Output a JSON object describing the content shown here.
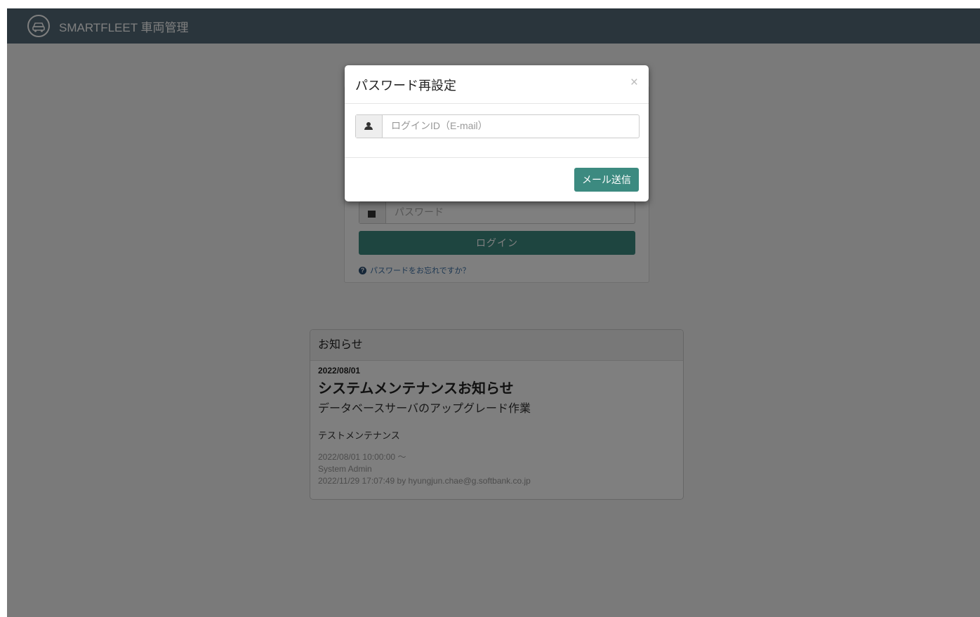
{
  "header": {
    "brand": "SMARTFLEET 車両管理",
    "logo_icon": "car-icon"
  },
  "login": {
    "password_placeholder": "パスワード",
    "login_button": "ログイン",
    "forgot_link": "パスワードをお忘れですか？"
  },
  "news": {
    "heading": "お知らせ",
    "date": "2022/08/01",
    "title": "システムメンテナンスお知らせ",
    "subtitle": "データベースサーバのアップグレード作業",
    "content": "テストメンテナンス",
    "period": "2022/08/01 10:00:00 〜",
    "author": "System Admin",
    "updated": "2022/11/29 17:07:49 by hyungjun.chae@g.softbank.co.jp"
  },
  "modal": {
    "title": "パスワード再設定",
    "close_symbol": "×",
    "email_placeholder": "ログインID（E-mail）",
    "email_value": "",
    "send_button": "メール送信"
  },
  "colors": {
    "navbar": "#546b78",
    "primary_button": "#3c8a80",
    "overlay": "rgba(0,0,0,0.5)"
  }
}
